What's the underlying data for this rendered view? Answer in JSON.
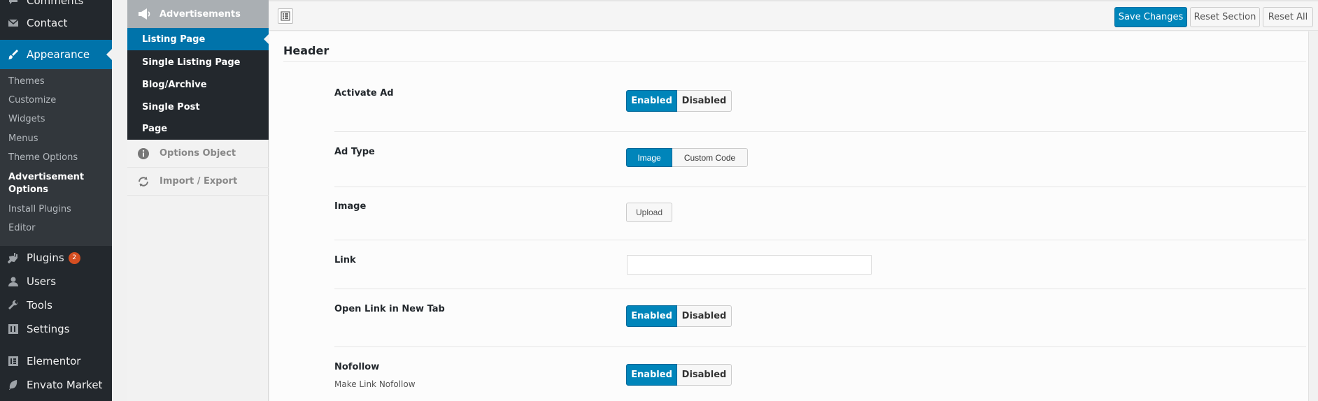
{
  "wp_menu": {
    "comments": "Comments",
    "contact": "Contact",
    "appearance": "Appearance",
    "submenu": [
      "Themes",
      "Customize",
      "Widgets",
      "Menus",
      "Theme Options",
      "Advertisement Options",
      "Install Plugins",
      "Editor"
    ],
    "plugins": "Plugins",
    "plugins_badge": "2",
    "users": "Users",
    "tools": "Tools",
    "settings": "Settings",
    "elementor": "Elementor",
    "envato": "Envato Market"
  },
  "redux_nav": {
    "group": "Advertisements",
    "subs": [
      "Listing Page",
      "Single Listing Page",
      "Blog/Archive",
      "Single Post",
      "Page"
    ],
    "options_object": "Options Object",
    "import_export": "Import / Export"
  },
  "toolbar": {
    "save": "Save Changes",
    "reset_section": "Reset Section",
    "reset_all": "Reset All"
  },
  "section": {
    "title": "Header",
    "fields": {
      "activate_ad": {
        "label": "Activate Ad",
        "on": "Enabled",
        "off": "Disabled"
      },
      "ad_type": {
        "label": "Ad Type",
        "opt1": "Image",
        "opt2": "Custom Code"
      },
      "image": {
        "label": "Image",
        "upload": "Upload"
      },
      "link": {
        "label": "Link",
        "value": ""
      },
      "new_tab": {
        "label": "Open Link in New Tab",
        "on": "Enabled",
        "off": "Disabled"
      },
      "nofollow": {
        "label": "Nofollow",
        "desc": "Make Link Nofollow",
        "on": "Enabled",
        "off": "Disabled"
      }
    }
  },
  "colors": {
    "wp_dark": "#23282d",
    "wp_blue": "#0073aa",
    "button_blue": "#0085ba",
    "badge_orange": "#d54e21"
  }
}
